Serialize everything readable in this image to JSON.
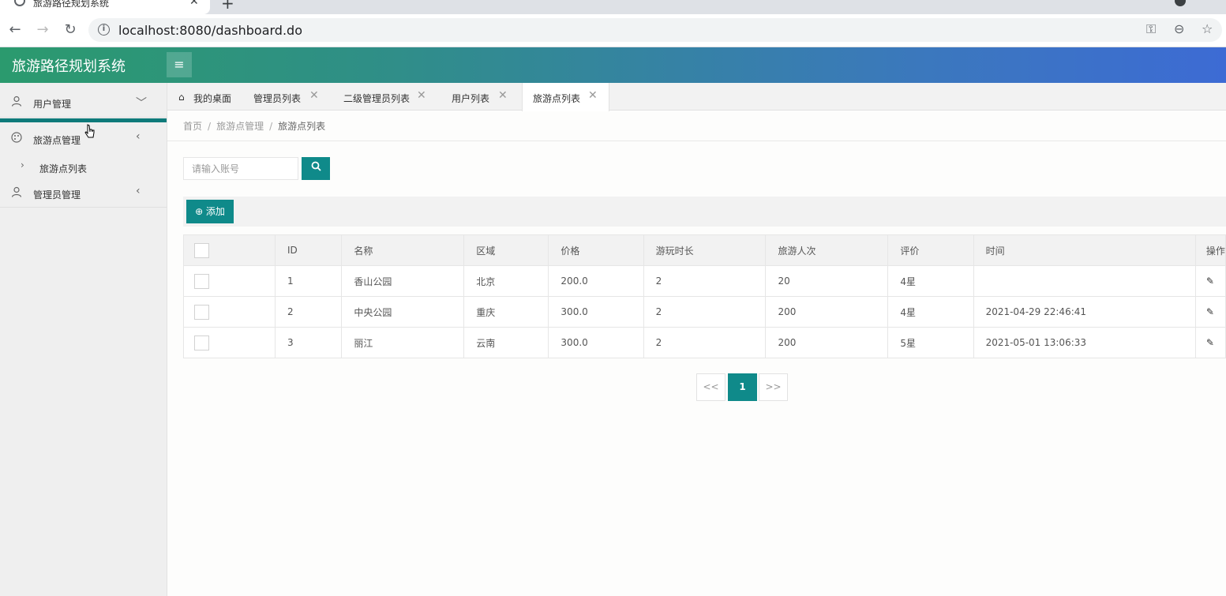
{
  "browser": {
    "tab_title": "旅游路径规划系统",
    "tab_close": "✕",
    "new_tab": "+",
    "back": "←",
    "forward": "→",
    "reload": "↻",
    "info": "i",
    "url": "localhost:8080/dashboard.do"
  },
  "header": {
    "app_title": "旅游路径规划系统",
    "menu_icon": "≡"
  },
  "sidebar": {
    "items": [
      {
        "label": "用户管理",
        "icon": "user-icon",
        "arrow": "﹀"
      },
      {
        "label": "旅游点管理",
        "icon": "palette-icon",
        "arrow": "‹"
      },
      {
        "label": "管理员管理",
        "icon": "user-icon",
        "arrow": "‹"
      }
    ],
    "sub_items": [
      {
        "label": "旅游点列表",
        "arrow": "›"
      }
    ]
  },
  "tabs": [
    {
      "label": "我的桌面",
      "icon": "home-icon",
      "closable": false
    },
    {
      "label": "管理员列表",
      "closable": true
    },
    {
      "label": "二级管理员列表",
      "closable": true
    },
    {
      "label": "用户列表",
      "closable": true
    },
    {
      "label": "旅游点列表",
      "closable": true,
      "active": true
    }
  ],
  "tab_close": "✕",
  "breadcrumb": {
    "home": "首页",
    "section": "旅游点管理",
    "current": "旅游点列表",
    "sep": "/"
  },
  "search": {
    "placeholder": "请输入账号",
    "button_icon": "🔍"
  },
  "actions": {
    "add_label": "⊕ 添加"
  },
  "table": {
    "columns": [
      "ID",
      "名称",
      "区域",
      "价格",
      "游玩时长",
      "旅游人次",
      "评价",
      "时间",
      "操作"
    ],
    "rows": [
      {
        "id": "1",
        "name": "香山公园",
        "region": "北京",
        "price": "200.0",
        "duration": "2",
        "visitors": "20",
        "rating": "4星",
        "time": ""
      },
      {
        "id": "2",
        "name": "中央公园",
        "region": "重庆",
        "price": "300.0",
        "duration": "2",
        "visitors": "200",
        "rating": "4星",
        "time": "2021-04-29 22:46:41"
      },
      {
        "id": "3",
        "name": "丽江",
        "region": "云南",
        "price": "300.0",
        "duration": "2",
        "visitors": "200",
        "rating": "5星",
        "time": "2021-05-01 13:06:33"
      }
    ],
    "edit_icon": "✎"
  },
  "pagination": {
    "prev": "<<",
    "current": "1",
    "next": ">>"
  },
  "colors": {
    "primary": "#0f8a8a",
    "header_start": "#2b9a6e",
    "header_end": "#3d6bd4"
  }
}
